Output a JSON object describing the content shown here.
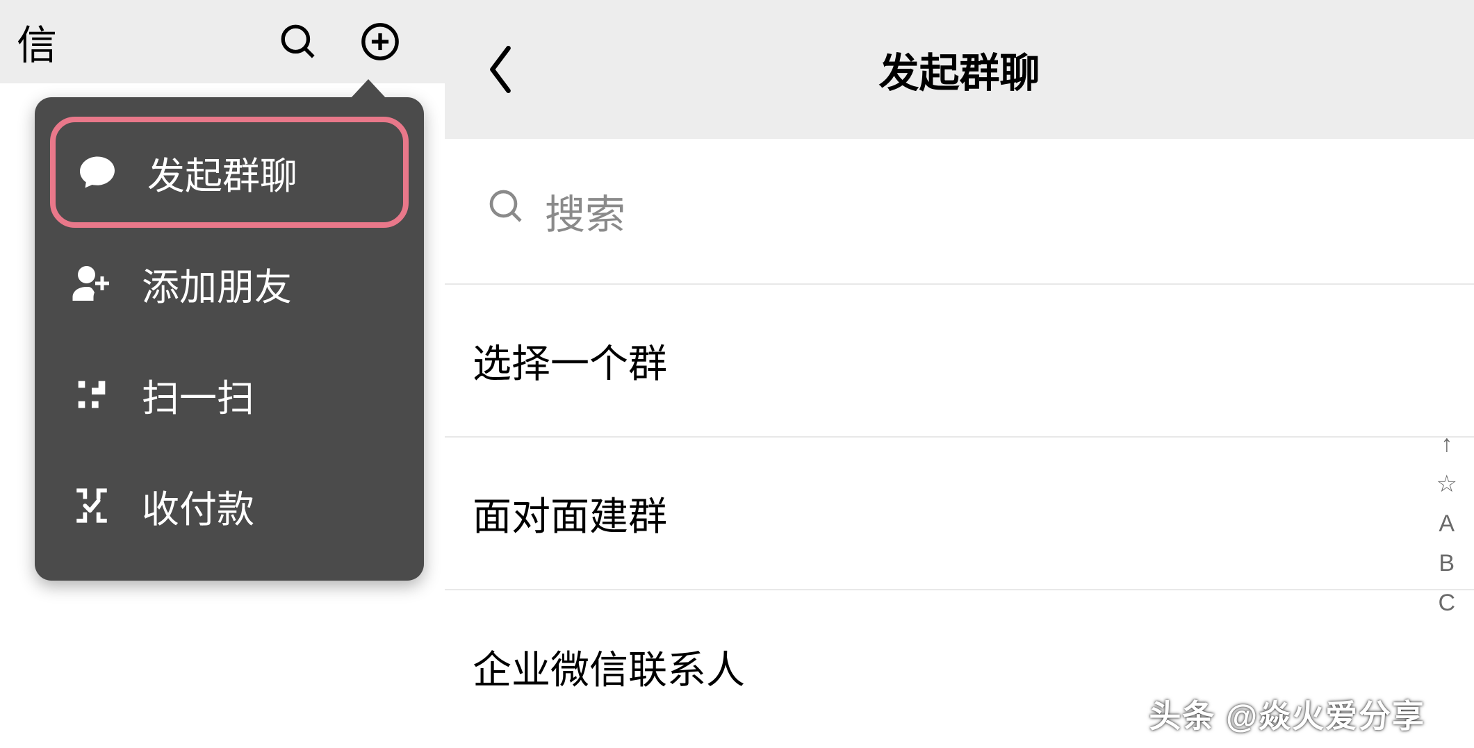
{
  "left": {
    "title": "信",
    "dropdown": {
      "items": [
        {
          "label": "发起群聊",
          "icon": "chat-bubble-icon",
          "highlight": true
        },
        {
          "label": "添加朋友",
          "icon": "add-friend-icon",
          "highlight": false
        },
        {
          "label": "扫一扫",
          "icon": "scan-icon",
          "highlight": false
        },
        {
          "label": "收付款",
          "icon": "payment-icon",
          "highlight": false
        }
      ]
    }
  },
  "right": {
    "title": "发起群聊",
    "search_placeholder": "搜索",
    "options": [
      "选择一个群",
      "面对面建群",
      "企业微信联系人"
    ],
    "index_bar": [
      "↑",
      "☆",
      "A",
      "B",
      "C"
    ]
  },
  "watermark": "头条 @焱火爱分享",
  "colors": {
    "highlight_border": "#e9788a",
    "arrow": "#e9788a",
    "menu_bg": "#4b4b4b",
    "header_bg": "#ededed"
  }
}
